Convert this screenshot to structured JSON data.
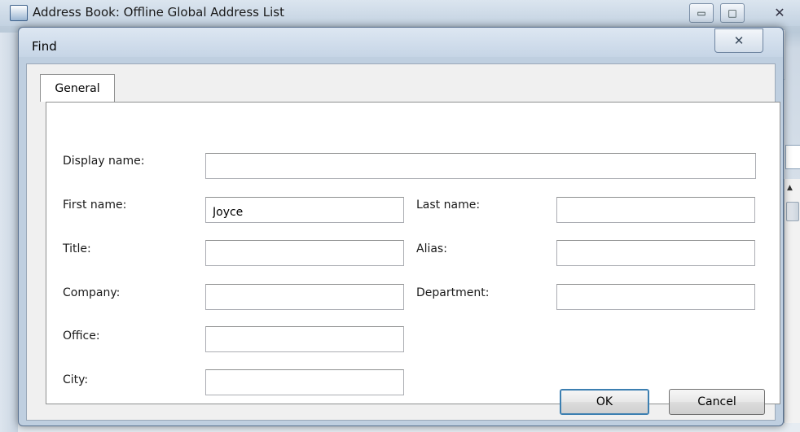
{
  "background_window": {
    "title": "Address Book: Offline Global Address List",
    "minimize_glyph": "▭",
    "maximize_glyph": "□",
    "close_glyph": "✕"
  },
  "dialog": {
    "title": "Find",
    "close_glyph": "✕",
    "tab": {
      "label": "General"
    },
    "fields": {
      "display_name": {
        "label": "Display name:",
        "value": ""
      },
      "first_name": {
        "label": "First name:",
        "value": "Joyce"
      },
      "last_name": {
        "label": "Last name:",
        "value": ""
      },
      "title": {
        "label": "Title:",
        "value": ""
      },
      "alias": {
        "label": "Alias:",
        "value": ""
      },
      "company": {
        "label": "Company:",
        "value": ""
      },
      "department": {
        "label": "Department:",
        "value": ""
      },
      "office": {
        "label": "Office:",
        "value": ""
      },
      "city": {
        "label": "City:",
        "value": ""
      }
    },
    "buttons": {
      "ok": "OK",
      "cancel": "Cancel"
    }
  }
}
